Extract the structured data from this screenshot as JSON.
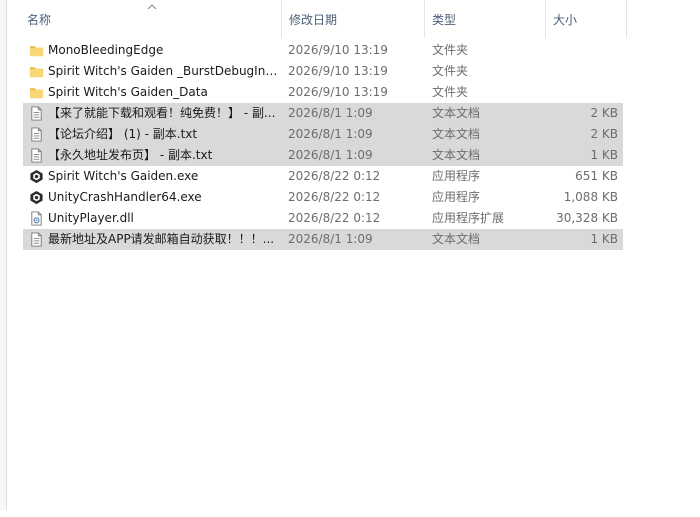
{
  "columns": {
    "name": "名称",
    "date": "修改日期",
    "type": "类型",
    "size": "大小"
  },
  "files": [
    {
      "name": "MonoBleedingEdge",
      "date": "2026/9/10 13:19",
      "type": "文件夹",
      "size": "",
      "icon": "folder-icon",
      "selected": false
    },
    {
      "name": "Spirit Witch's Gaiden _BurstDebugInf...",
      "date": "2026/9/10 13:19",
      "type": "文件夹",
      "size": "",
      "icon": "folder-icon",
      "selected": false
    },
    {
      "name": "Spirit Witch's Gaiden_Data",
      "date": "2026/9/10 13:19",
      "type": "文件夹",
      "size": "",
      "icon": "folder-icon",
      "selected": false
    },
    {
      "name": "【来了就能下载和观看！纯免费！】 - 副...",
      "date": "2026/8/1 1:09",
      "type": "文本文档",
      "size": "2 KB",
      "icon": "text-file-icon",
      "selected": true
    },
    {
      "name": "【论坛介绍】 (1) - 副本.txt",
      "date": "2026/8/1 1:09",
      "type": "文本文档",
      "size": "2 KB",
      "icon": "text-file-icon",
      "selected": true
    },
    {
      "name": "【永久地址发布页】 - 副本.txt",
      "date": "2026/8/1 1:09",
      "type": "文本文档",
      "size": "1 KB",
      "icon": "text-file-icon",
      "selected": true
    },
    {
      "name": "Spirit Witch's Gaiden.exe",
      "date": "2026/8/22 0:12",
      "type": "应用程序",
      "size": "651 KB",
      "icon": "unity-app-icon",
      "selected": false
    },
    {
      "name": "UnityCrashHandler64.exe",
      "date": "2026/8/22 0:12",
      "type": "应用程序",
      "size": "1,088 KB",
      "icon": "unity-app-icon",
      "selected": false
    },
    {
      "name": "UnityPlayer.dll",
      "date": "2026/8/22 0:12",
      "type": "应用程序扩展",
      "size": "30,328 KB",
      "icon": "dll-file-icon",
      "selected": false
    },
    {
      "name": "最新地址及APP请发邮箱自动获取！！！...",
      "date": "2026/8/1 1:09",
      "type": "文本文档",
      "size": "1 KB",
      "icon": "text-file-icon",
      "selected": true
    }
  ],
  "colors": {
    "selection": "#d9d9d9",
    "header_text": "#4c607a",
    "folder": "#f8d775",
    "secondary_text": "#6d6d6d"
  }
}
